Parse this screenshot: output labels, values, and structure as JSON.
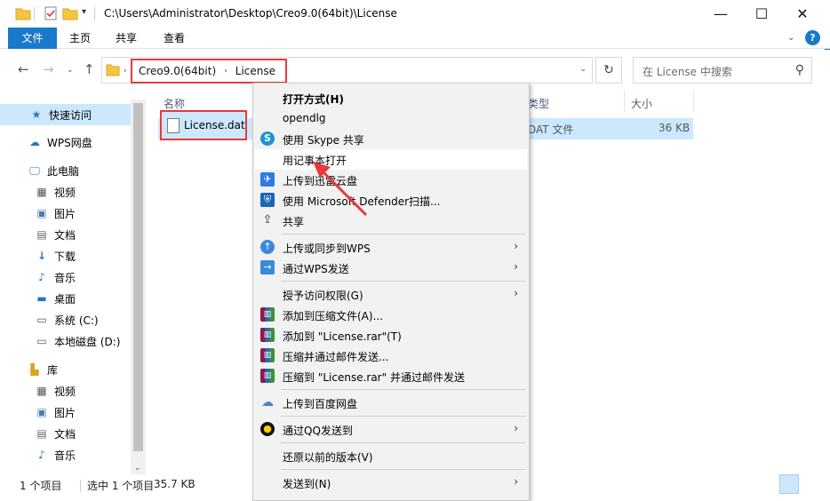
{
  "window": {
    "title": "C:\\Users\\Administrator\\Desktop\\Creo9.0(64bit)\\License",
    "minimize": "—",
    "maximize": "☐",
    "close": "✕"
  },
  "ribbon": {
    "tabs": [
      "文件",
      "主页",
      "共享",
      "查看"
    ],
    "help": "?"
  },
  "address": {
    "crumbs": [
      "Creo9.0(64bit)",
      "License"
    ],
    "search_placeholder": "在 License 中搜索"
  },
  "sidebar": {
    "items": [
      {
        "label": "快速访问",
        "icon": "star-icon"
      },
      {
        "label": "WPS网盘",
        "icon": "cloud-icon"
      },
      {
        "label": "此电脑",
        "icon": "pc-icon"
      },
      {
        "label": "视频",
        "icon": "video-icon"
      },
      {
        "label": "图片",
        "icon": "picture-icon"
      },
      {
        "label": "文档",
        "icon": "document-icon"
      },
      {
        "label": "下载",
        "icon": "download-icon"
      },
      {
        "label": "音乐",
        "icon": "music-icon"
      },
      {
        "label": "桌面",
        "icon": "desktop-icon"
      },
      {
        "label": "系统 (C:)",
        "icon": "drive-icon"
      },
      {
        "label": "本地磁盘 (D:)",
        "icon": "drive-icon"
      },
      {
        "label": "库",
        "icon": "library-icon"
      },
      {
        "label": "视频",
        "icon": "video-icon"
      },
      {
        "label": "图片",
        "icon": "picture-icon"
      },
      {
        "label": "文档",
        "icon": "document-icon"
      },
      {
        "label": "音乐",
        "icon": "music-icon"
      }
    ]
  },
  "filelist": {
    "columns": {
      "name": "名称",
      "type": "类型",
      "size": "大小"
    },
    "files": [
      {
        "name": "License.dat",
        "type": "DAT 文件",
        "size": "36 KB"
      }
    ]
  },
  "status": {
    "count": "1 个项目",
    "selected": "选中 1 个项目",
    "size": "35.7 KB"
  },
  "context_menu": {
    "items": [
      {
        "label": "打开方式(H)"
      },
      {
        "label": "opendlg"
      },
      {
        "label": "使用 Skype 共享",
        "icon": "skype-icon"
      },
      {
        "label": "用记事本打开"
      },
      {
        "label": "上传到迅雷云盘",
        "icon": "xunlei-icon"
      },
      {
        "label": "使用 Microsoft Defender扫描...",
        "icon": "defender-icon"
      },
      {
        "label": "共享",
        "icon": "share-icon"
      },
      {
        "label": "上传或同步到WPS",
        "icon": "wps-sync-icon"
      },
      {
        "label": "通过WPS发送",
        "icon": "wps-send-icon"
      },
      {
        "label": "授予访问权限(G)"
      },
      {
        "label": "添加到压缩文件(A)...",
        "icon": "winrar-icon"
      },
      {
        "label": "添加到 \"License.rar\"(T)",
        "icon": "winrar-icon"
      },
      {
        "label": "压缩并通过邮件发送...",
        "icon": "winrar-icon"
      },
      {
        "label": "压缩到 \"License.rar\" 并通过邮件发送",
        "icon": "winrar-icon"
      },
      {
        "label": "上传到百度网盘",
        "icon": "baidu-icon"
      },
      {
        "label": "通过QQ发送到",
        "icon": "qq-icon"
      },
      {
        "label": "还原以前的版本(V)"
      },
      {
        "label": "发送到(N)"
      }
    ]
  },
  "colors": {
    "accent": "#1979ca",
    "selection": "#cce8ff",
    "highlight": "#e63a3a"
  }
}
